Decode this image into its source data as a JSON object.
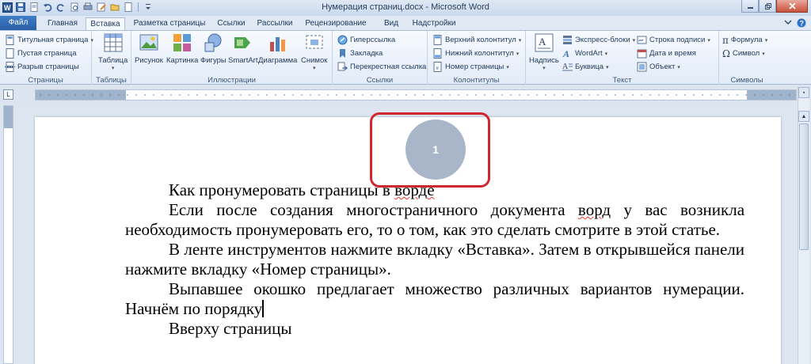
{
  "window": {
    "title": "Нумерация страниц.docx - Microsoft Word"
  },
  "tabs": [
    "Файл",
    "Главная",
    "Вставка",
    "Разметка страницы",
    "Ссылки",
    "Рассылки",
    "Рецензирование",
    "Вид",
    "Надстройки"
  ],
  "active_tab": "Вставка",
  "ribbon": {
    "pages": {
      "label": "Страницы",
      "cover": "Титульная страница",
      "blank": "Пустая страница",
      "break": "Разрыв страницы"
    },
    "tables": {
      "label": "Таблицы",
      "table": "Таблица"
    },
    "illustrations": {
      "label": "Иллюстрации",
      "picture": "Рисунок",
      "clipart": "Картинка",
      "shapes": "Фигуры",
      "smartart": "SmartArt",
      "chart": "Диаграмма",
      "screenshot": "Снимок"
    },
    "links": {
      "label": "Ссылки",
      "hyperlink": "Гиперссылка",
      "bookmark": "Закладка",
      "crossref": "Перекрестная ссылка"
    },
    "headerfooter": {
      "label": "Колонтитулы",
      "header": "Верхний колонтитул",
      "footer": "Нижний колонтитул",
      "pagenum": "Номер страницы"
    },
    "text": {
      "label": "Текст",
      "textbox": "Надпись",
      "quickparts": "Экспресс-блоки",
      "wordart": "WordArt",
      "dropcap": "Буквица",
      "signature": "Строка подписи",
      "datetime": "Дата и время",
      "object": "Объект"
    },
    "symbols": {
      "label": "Символы",
      "equation": "Формула",
      "symbol": "Символ"
    }
  },
  "document": {
    "page_number": "1",
    "heading": "Как пронумеровать страницы в ",
    "heading_word": "ворде",
    "p1_a": "Если после создания многостраничного документа ",
    "p1_word": "ворд",
    "p1_b": " у вас возникла необходимость пронумеровать его, то о том, как это сделать смотрите в этой статье.",
    "p2": "В ленте инструментов нажмите вкладку «Вставка». Затем в открывшейся панели нажмите вкладку «Номер страницы».",
    "p3": "Выпавшее окошко предлагает множество различных вариантов нумерации. Начнём по порядку",
    "p4": "Вверху страницы"
  },
  "colors": {
    "accent": "#2a5ea6",
    "highlight": "#d0262d",
    "page_number_bg": "#a9b6c9"
  }
}
